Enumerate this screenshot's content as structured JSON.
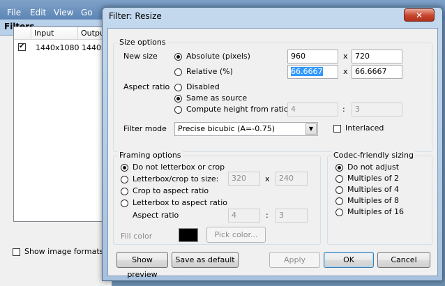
{
  "background": {
    "menu": [
      "File",
      "Edit",
      "View",
      "Go"
    ],
    "filters_window_title": "Filters",
    "list_columns": [
      "Input",
      "Outpu"
    ],
    "list_rows": [
      {
        "input": "1440x1080",
        "output": "1440x"
      }
    ],
    "show_image_formats_label": "Show image formats"
  },
  "dialog": {
    "title": "Filter: Resize",
    "close_glyph": "✕",
    "size_options": {
      "legend": "Size options",
      "new_size_label": "New size",
      "absolute_label": "Absolute (pixels)",
      "relative_label": "Relative (%)",
      "abs_width": "960",
      "abs_height": "720",
      "rel_width": "66.6667",
      "rel_height": "66.6667",
      "x_sep": "x",
      "aspect_label": "Aspect ratio",
      "aspect_disabled": "Disabled",
      "aspect_same": "Same as source",
      "aspect_compute": "Compute height from ratio:",
      "ratio_num": "4",
      "ratio_den": "3",
      "colon": ":",
      "filter_mode_label": "Filter mode",
      "filter_mode_value": "Precise bicubic (A=-0.75)",
      "interlaced_label": "Interlaced"
    },
    "framing": {
      "legend": "Framing options",
      "no_letterbox": "Do not letterbox or crop",
      "letterbox_size": "Letterbox/crop to size:",
      "crop_aspect": "Crop to aspect ratio",
      "letterbox_aspect": "Letterbox to aspect ratio",
      "size_w": "320",
      "size_h": "240",
      "x_sep": "x",
      "aspect_label": "Aspect ratio",
      "aspect_num": "4",
      "aspect_den": "3",
      "colon": ":",
      "fill_color_label": "Fill color",
      "fill_color": "#000000",
      "pick_color_label": "Pick color..."
    },
    "codec": {
      "legend": "Codec-friendly sizing",
      "options": [
        "Do not adjust",
        "Multiples of 2",
        "Multiples of 4",
        "Multiples of 8",
        "Multiples of 16"
      ]
    },
    "buttons": {
      "show_preview": "Show preview",
      "save_default": "Save as default",
      "apply": "Apply",
      "ok": "OK",
      "cancel": "Cancel"
    }
  }
}
